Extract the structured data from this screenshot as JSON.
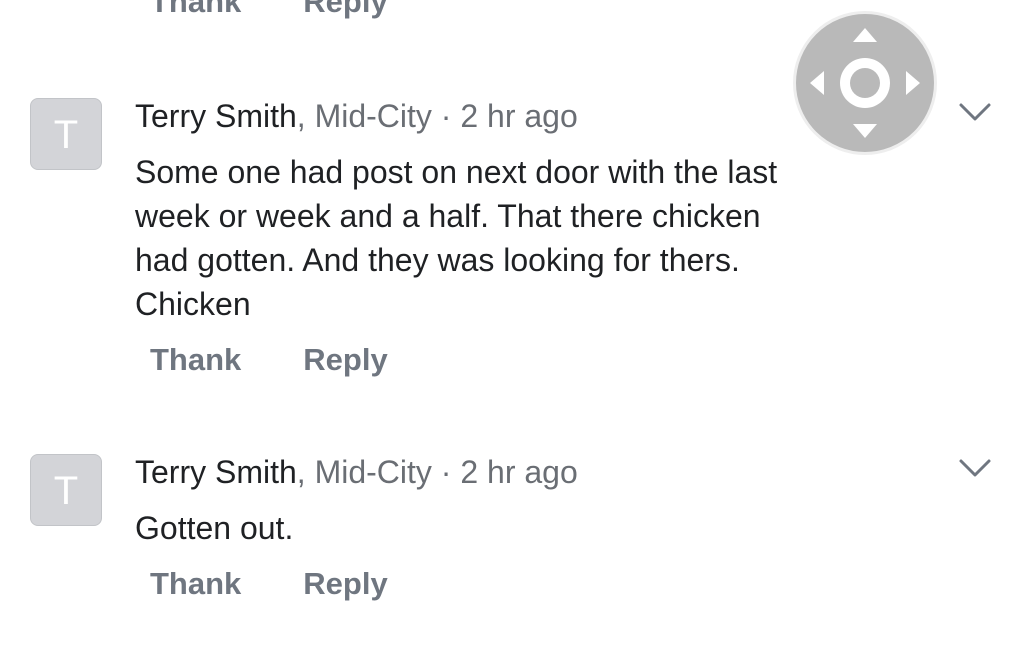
{
  "top_actions": {
    "thank_label": "Thank",
    "reply_label": "Reply"
  },
  "comments": [
    {
      "avatar_initial": "T",
      "author": "Terry Smith",
      "separator": ", ",
      "neighborhood": "Mid-City",
      "dot": " · ",
      "time_ago": "2 hr ago",
      "text": "Some one had post on next door with the last\nweek or week and a half.  That there chicken\nhad gotten. And they was looking for thers.\nChicken",
      "thank_label": "Thank",
      "reply_label": "Reply"
    },
    {
      "avatar_initial": "T",
      "author": "Terry Smith",
      "separator": ", ",
      "neighborhood": "Mid-City",
      "dot": " · ",
      "time_ago": "2 hr ago",
      "text": "Gotten out.",
      "thank_label": "Thank",
      "reply_label": "Reply"
    }
  ],
  "icons": {
    "chevron": "chevron-down-icon",
    "floating_control": "assistive-touch-dpad-icon"
  },
  "colors": {
    "action_text": "#6f7680",
    "meta_text": "#6a6e74",
    "avatar_bg": "#d3d4d8",
    "floating_control": "#b9b9b9"
  }
}
